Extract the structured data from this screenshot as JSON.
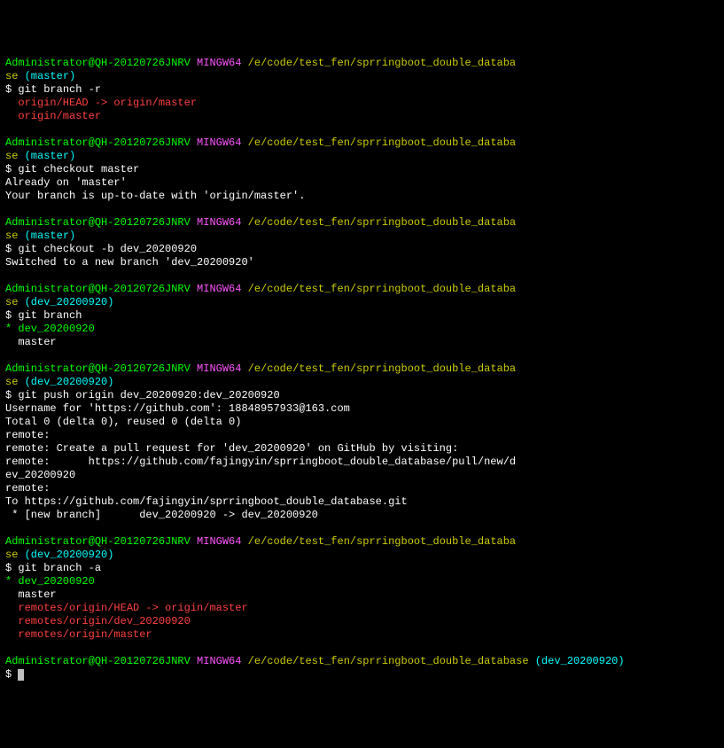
{
  "prompt": {
    "user_host": "Administrator@QH-20120726JNRV",
    "mingw": "MINGW64",
    "path_wrapped_a": "/e/code/test_fen/sprringboot_double_databa",
    "path_wrapped_b": "se",
    "path_full": "/e/code/test_fen/sprringboot_double_database",
    "branch_master": "(master)",
    "branch_dev": "(dev_20200920)",
    "dollar": "$"
  },
  "cmd": {
    "branch_r": "git branch -r",
    "checkout_master": "git checkout master",
    "checkout_b": "git checkout -b dev_20200920",
    "branch": "git branch",
    "push": "git push origin dev_20200920:dev_20200920",
    "branch_a": "git branch -a"
  },
  "out": {
    "branch_r1": "  origin/HEAD -> origin/master",
    "branch_r2": "  origin/master",
    "already": "Already on 'master'",
    "uptodate": "Your branch is up-to-date with 'origin/master'.",
    "switched": "Switched to a new branch 'dev_20200920'",
    "star_dev": "* dev_20200920",
    "master": "  master",
    "push_user": "Username for 'https://github.com': 18848957933@163.com",
    "push_total": "Total 0 (delta 0), reused 0 (delta 0)",
    "push_r1": "remote:",
    "push_r2": "remote: Create a pull request for 'dev_20200920' on GitHub by visiting:",
    "push_r3": "remote:      https://github.com/fajingyin/sprringboot_double_database/pull/new/d",
    "push_r4": "ev_20200920",
    "push_r5": "remote:",
    "push_to": "To https://github.com/fajingyin/sprringboot_double_database.git",
    "push_newbranch": " * [new branch]      dev_20200920 -> dev_20200920",
    "ba_r1": "  remotes/origin/HEAD -> origin/master",
    "ba_r2": "  remotes/origin/dev_20200920",
    "ba_r3": "  remotes/origin/master"
  }
}
